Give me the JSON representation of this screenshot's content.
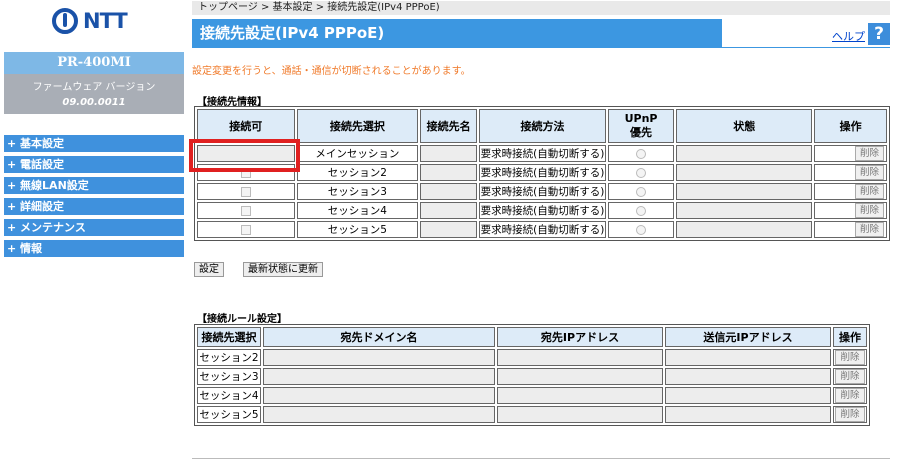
{
  "sidebar": {
    "logo_text": "NTT",
    "model": "PR-400MI",
    "firmware_label": "ファームウェア バージョン",
    "firmware_version": "09.00.0011",
    "menu": [
      {
        "label": "+ 基本設定"
      },
      {
        "label": "+ 電話設定"
      },
      {
        "label": "+ 無線LAN設定"
      },
      {
        "label": "+ 詳細設定"
      },
      {
        "label": "+ メンテナンス"
      },
      {
        "label": "+ 情報"
      }
    ]
  },
  "breadcrumb": "トップページ > 基本設定 > 接続先設定(IPv4 PPPoE)",
  "header": {
    "title": "接続先設定(IPv4 PPPoE)",
    "help_label": "ヘルプ",
    "help_icon": "?"
  },
  "notice": "設定変更を行うと、通話・通信が切断されることがあります。",
  "connection_info": {
    "title": "【接続先情報】",
    "headers": [
      "接続可",
      "接続先選択",
      "接続先名",
      "接続方法",
      "UPnP\n優先",
      "状態",
      "操作"
    ],
    "rows": [
      {
        "session": "メインセッション",
        "method": "要求時接続(自動切断する)",
        "action": "削除"
      },
      {
        "session": "セッション2",
        "method": "要求時接続(自動切断する)",
        "action": "削除"
      },
      {
        "session": "セッション3",
        "method": "要求時接続(自動切断する)",
        "action": "削除"
      },
      {
        "session": "セッション4",
        "method": "要求時接続(自動切断する)",
        "action": "削除"
      },
      {
        "session": "セッション5",
        "method": "要求時接続(自動切断する)",
        "action": "削除"
      }
    ]
  },
  "buttons": {
    "apply": "設定",
    "refresh": "最新状態に更新"
  },
  "rule_settings": {
    "title": "【接続ルール設定】",
    "headers": [
      "接続先選択",
      "宛先ドメイン名",
      "宛先IPアドレス",
      "送信元IPアドレス",
      "操作"
    ],
    "rows": [
      {
        "session": "セッション2",
        "action": "削除"
      },
      {
        "session": "セッション3",
        "action": "削除"
      },
      {
        "session": "セッション4",
        "action": "削除"
      },
      {
        "session": "セッション5",
        "action": "削除"
      }
    ]
  },
  "colors": {
    "accent": "#3c97e1",
    "notice": "#f07a2a",
    "highlight": "#e02020"
  }
}
